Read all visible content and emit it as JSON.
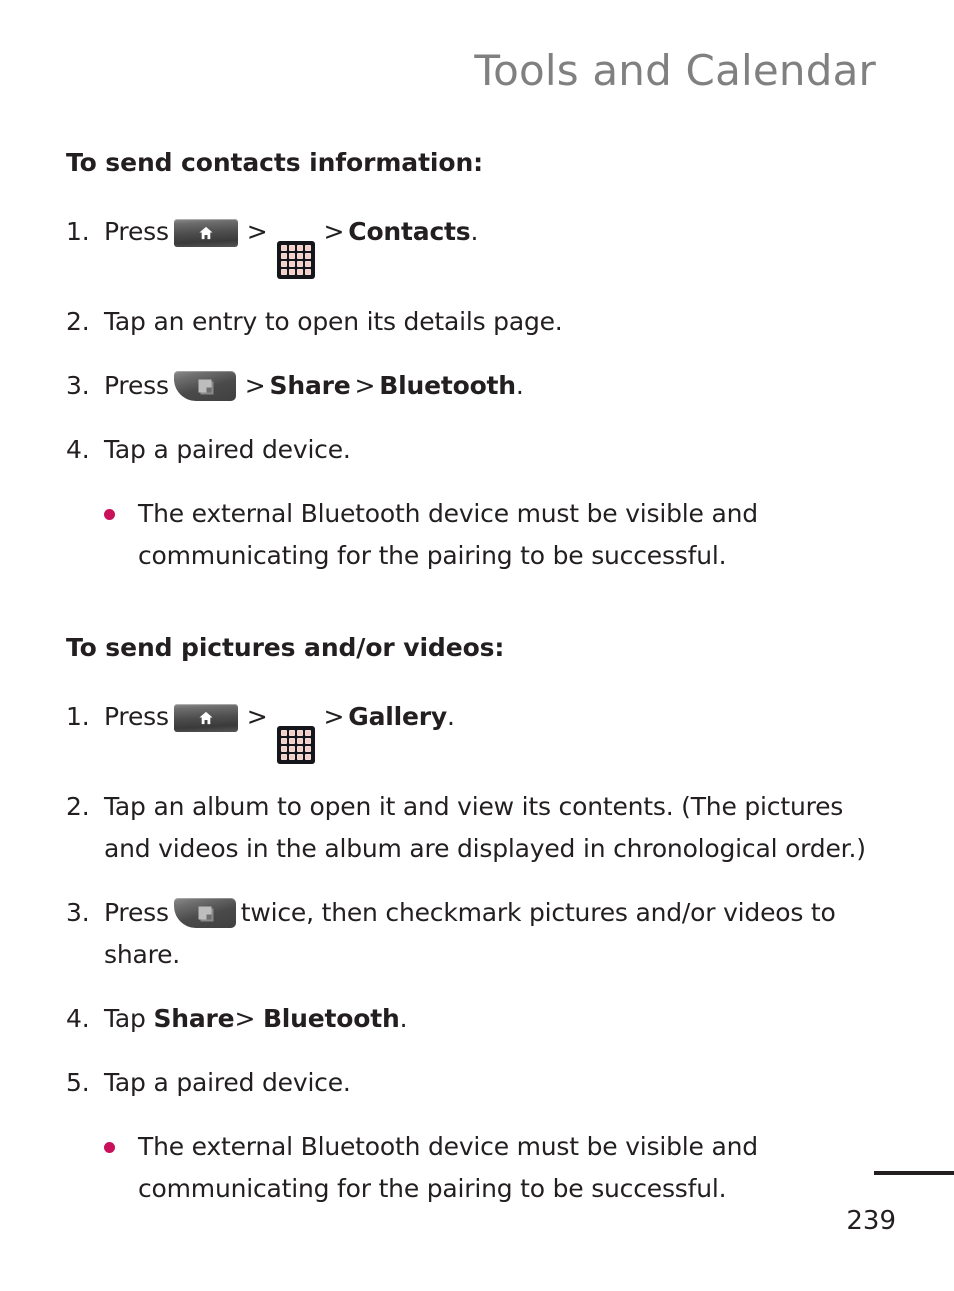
{
  "header": {
    "chapter_title": "Tools and Calendar",
    "color": "#818081"
  },
  "colors": {
    "text": "#231f20",
    "bullet": "#c9105b",
    "header_gray": "#818081",
    "apps_icon_bg": "#15151c",
    "apps_icon_cell": "#f3cfc8"
  },
  "sections": [
    {
      "title": "To send contacts information:",
      "steps": [
        {
          "number": "1.",
          "parts": [
            {
              "type": "text",
              "value": "Press"
            },
            {
              "type": "icon",
              "icon": "home-key-icon"
            },
            {
              "type": "sep",
              "value": ">"
            },
            {
              "type": "icon",
              "icon": "apps-grid-icon"
            },
            {
              "type": "sep",
              "value": ">"
            },
            {
              "type": "bold",
              "value": "Contacts"
            },
            {
              "type": "text",
              "value": "."
            }
          ]
        },
        {
          "number": "2.",
          "parts": [
            {
              "type": "text",
              "value": "Tap an entry to open its details page."
            }
          ]
        },
        {
          "number": "3.",
          "parts": [
            {
              "type": "text",
              "value": "Press"
            },
            {
              "type": "icon",
              "icon": "menu-key-icon"
            },
            {
              "type": "sep",
              "value": ">"
            },
            {
              "type": "bold",
              "value": "Share"
            },
            {
              "type": "sep",
              "value": ">"
            },
            {
              "type": "bold",
              "value": "Bluetooth"
            },
            {
              "type": "text",
              "value": "."
            }
          ]
        },
        {
          "number": "4.",
          "parts": [
            {
              "type": "text",
              "value": "Tap a paired device."
            }
          ]
        }
      ],
      "bullets": [
        "The external Bluetooth device must be visible and communicating for the pairing to be successful."
      ]
    },
    {
      "title": "To send pictures and/or videos:",
      "steps": [
        {
          "number": "1.",
          "parts": [
            {
              "type": "text",
              "value": "Press"
            },
            {
              "type": "icon",
              "icon": "home-key-icon"
            },
            {
              "type": "sep",
              "value": ">"
            },
            {
              "type": "icon",
              "icon": "apps-grid-icon"
            },
            {
              "type": "sep",
              "value": ">"
            },
            {
              "type": "bold",
              "value": "Gallery"
            },
            {
              "type": "text",
              "value": "."
            }
          ]
        },
        {
          "number": "2.",
          "parts": [
            {
              "type": "text",
              "value": "Tap an album to open it and view its contents. (The pictures and videos in the album are displayed in chronological order.)"
            }
          ]
        },
        {
          "number": "3.",
          "parts": [
            {
              "type": "text",
              "value": "Press"
            },
            {
              "type": "icon",
              "icon": "menu-key-icon"
            },
            {
              "type": "text",
              "value": "twice, then checkmark pictures and/or videos to share."
            }
          ]
        },
        {
          "number": "4.",
          "parts": [
            {
              "type": "text",
              "value": "Tap"
            },
            {
              "type": "bold",
              "value": "Share"
            },
            {
              "type": "text",
              "value": ">"
            },
            {
              "type": "bold",
              "value": "Bluetooth"
            },
            {
              "type": "text",
              "value": "."
            }
          ]
        },
        {
          "number": "5.",
          "parts": [
            {
              "type": "text",
              "value": "Tap a paired device."
            }
          ]
        }
      ],
      "bullets": [
        "The external Bluetooth device must be visible and communicating for the pairing to be successful."
      ]
    }
  ],
  "footer": {
    "page_number": "239"
  },
  "s1": {
    "title": "To send contacts information:",
    "step1_press": "Press",
    "step1_gt1": ">",
    "step1_gt2": ">",
    "step1_contacts": "Contacts",
    "step1_period": ".",
    "step2": "Tap an entry to open its details page.",
    "step3_press": "Press",
    "step3_gt1": ">",
    "step3_share": "Share",
    "step3_gt2": ">",
    "step3_bluetooth": "Bluetooth",
    "step3_period": ".",
    "step4": "Tap a paired device.",
    "bullet1": "The external Bluetooth device must be visible and communicating for the pairing to be successful.",
    "n1": "1.",
    "n2": "2.",
    "n3": "3.",
    "n4": "4."
  },
  "s2": {
    "title": "To send pictures and/or videos:",
    "step1_press": "Press",
    "step1_gt1": ">",
    "step1_gt2": ">",
    "step1_gallery": "Gallery",
    "step1_period": ".",
    "step2": "Tap an album to open it and view its contents. (The pictures and videos in the album are displayed in chronological order.)",
    "step3_press": "Press",
    "step3_rest": "twice, then checkmark pictures and/or videos to share.",
    "step4_tap": "Tap",
    "step4_share": "Share",
    "step4_gt": ">",
    "step4_bluetooth": "Bluetooth",
    "step4_period": ".",
    "step5": "Tap a paired device.",
    "bullet1": "The external Bluetooth device must be visible and communicating for the pairing to be successful.",
    "n1": "1.",
    "n2": "2.",
    "n3": "3.",
    "n4": "4.",
    "n5": "5."
  }
}
